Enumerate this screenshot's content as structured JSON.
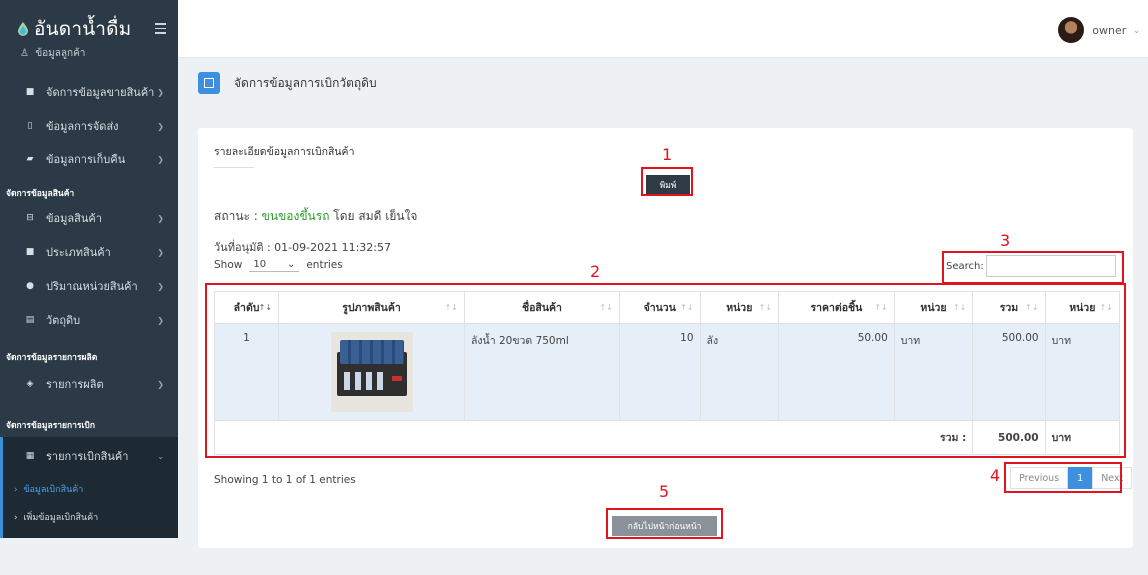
{
  "brand": {
    "name": "อันดาน้ำดื่ม"
  },
  "sidebar": {
    "partial_item": "ข้อมูลลูกค้า",
    "items": [
      {
        "label": "จัดการข้อมูลขายสินค้า",
        "icon": "bag-icon"
      },
      {
        "label": "ข้อมูลการจัดส่ง",
        "icon": "box-icon"
      },
      {
        "label": "ข้อมูลการเก็บคืน",
        "icon": "truck-icon"
      }
    ],
    "section_product": "จัดการข้อมูลสินค้า",
    "product_items": [
      {
        "label": "ข้อมูลสินค้า",
        "icon": "basket-icon"
      },
      {
        "label": "ประเภทสินค้า",
        "icon": "bag-icon"
      },
      {
        "label": "ปริมาณหน่วยสินค้า",
        "icon": "dot-icon"
      },
      {
        "label": "วัตถุดิบ",
        "icon": "list-icon"
      }
    ],
    "section_production": "จัดการข้อมูลรายการผลิต",
    "production_items": [
      {
        "label": "รายการผลิต",
        "icon": "layers-icon"
      }
    ],
    "section_withdraw": "จัดการข้อมูลรายการเบิก",
    "withdraw_item": {
      "label": "รายการเบิกสินค้า",
      "icon": "card-icon"
    },
    "withdraw_sub": [
      {
        "label": "ข้อมูลเบิกสินค้า"
      },
      {
        "label": "เพิ่มข้อมูลเบิกสินค้า"
      }
    ]
  },
  "topbar": {
    "user_name": "owner"
  },
  "page": {
    "title": "จัดการข้อมูลการเบิกวัตถุดิบ"
  },
  "card": {
    "title": "รายละเอียดข้อมูลการเบิกสินค้า",
    "print_label": "พิมพ์",
    "status_prefix": "สถานะ :",
    "status_value": "ขนของขึ้นรถ",
    "status_by": "โดย สมดี เย็นใจ",
    "approved": "วันที่อนุมัติ : 01-09-2021 11:32:57",
    "show_label": "Show",
    "show_value": "10",
    "entries_label": "entries",
    "search_label": "Search:",
    "search_value": "",
    "showing": "Showing 1 to 1 of 1 entries",
    "back_label": "กลับไปหน้าก่อนหน้า"
  },
  "table": {
    "headers": [
      "ลำดับ",
      "รูปภาพสินค้า",
      "ชื่อสินค้า",
      "จำนวน",
      "หน่วย",
      "ราคาต่อชิ้น",
      "หน่วย",
      "รวม",
      "หน่วย"
    ],
    "row": {
      "no": "1",
      "name": "ลังน้ำ 20ขวด 750ml",
      "qty": "10",
      "unit": "ลัง",
      "price": "50.00",
      "price_unit": "บาท",
      "total": "500.00",
      "total_unit": "บาท"
    },
    "footer": {
      "label": "รวม :",
      "total": "500.00",
      "unit": "บาท"
    }
  },
  "pager": {
    "previous": "Previous",
    "current": "1",
    "next": "Next"
  },
  "annotations": [
    "1",
    "2",
    "3",
    "4",
    "5"
  ],
  "colors": {
    "sidebar_bg": "#2b3a46",
    "accent": "#3d8fe0",
    "status_green": "#2a9d2a",
    "annotation_red": "#e0141e"
  }
}
